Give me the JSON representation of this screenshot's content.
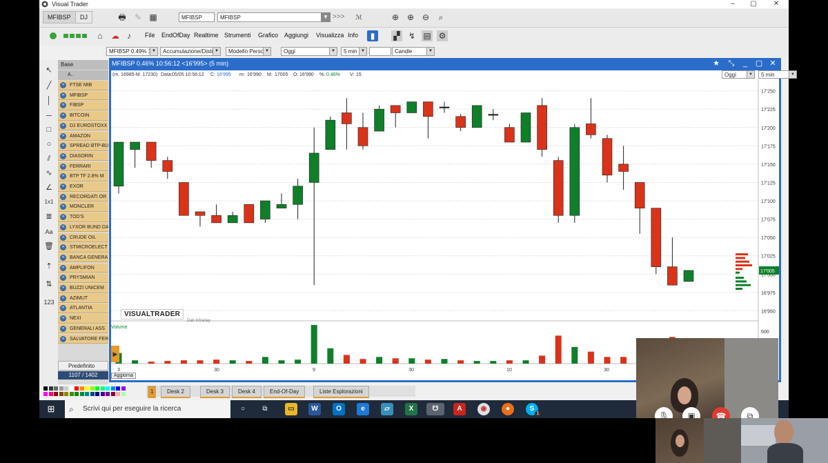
{
  "window": {
    "title": "Visual Trader"
  },
  "tabs": [
    "MFIBSP",
    "DJ"
  ],
  "symbol_inputs": {
    "left": "MFIBSP",
    "right": "MFIBSP"
  },
  "forward_label": ">>>",
  "menu": [
    "File",
    "EndOfDay",
    "Realtime",
    "Strumenti",
    "Grafico",
    "Aggiungi",
    "Visualizza",
    "Info"
  ],
  "toolbar3": {
    "instrument": "MFIBSP 0.49% 10:",
    "mode": "Accumulazione/Distri",
    "model": "Modello Person",
    "period": "Oggi",
    "interval": "5 min",
    "blank": "",
    "style": "Candle"
  },
  "watchlist": {
    "header": "Base",
    "column_header": "A.. Denominazione",
    "items": [
      "FTSE MIB",
      "MFIBSP",
      "FIBSP",
      "BITCOIN",
      "DJ EUROSTOXX",
      "AMAZON",
      "SPREAD BTP-BU",
      "DIASORIN",
      "FERRARI",
      "BTP TF 2.8% M",
      "EXOR",
      "RECORDATI OR",
      "MONCLER",
      "TOD'S",
      "LYXOR BUND DA",
      "CRUDE OIL",
      "STMICROELECT",
      "BANCA GENERA",
      "AMPLIFON",
      "PRYSMIAN",
      "BUZZI UNICEM",
      "AZIMUT",
      "ATLANTIA",
      "NEXI",
      "GENERALI ASS",
      "SALVATORE FER"
    ],
    "footer": "Predefinito",
    "count": "1107 / 1402"
  },
  "chart_window": {
    "title": "MFIBSP 0.46% 10:56:12  <16'995> (5 min)",
    "period": "Oggi",
    "interval": "5 min",
    "info": {
      "range": "(m. 16985-M. 17230)",
      "date_label": "Data:",
      "date": "05/05 10:56:12",
      "c_label": "C:",
      "c": "16'995",
      "m_label": "m:",
      "m": "16'990",
      "M_label": "M:",
      "M": "17005",
      "o_label": "O:",
      "o": "16'990",
      "pct_label": "%:",
      "pct": "0.46%",
      "v_label": "V:",
      "v": "15"
    },
    "brand": "VISUALTRADER",
    "brand_sub": "Dati Intraday",
    "volume_label": "Volume",
    "update_button": "Aggiorna",
    "last_price_tag": "17'005",
    "x_ticks": [
      "3",
      "30",
      "9",
      "30",
      "10",
      "30"
    ],
    "y_ticks": [
      "17'250",
      "17'225",
      "17'200",
      "17'175",
      "17'150",
      "17'125",
      "17'100",
      "17'075",
      "17'050",
      "17'025",
      "17'000",
      "16'975",
      "16'950"
    ],
    "vol_ticks": [
      "500",
      "37"
    ]
  },
  "chart_data": {
    "type": "candlestick",
    "ylim": [
      16940,
      17260
    ],
    "y_ticks": [
      17250,
      17225,
      17200,
      17175,
      17150,
      17125,
      17100,
      17075,
      17050,
      17025,
      17000,
      16975,
      16950
    ],
    "candles": [
      {
        "o": 17120,
        "h": 17180,
        "l": 17110,
        "c": 17180
      },
      {
        "o": 17170,
        "h": 17180,
        "l": 17145,
        "c": 17180
      },
      {
        "o": 17180,
        "h": 17180,
        "l": 17145,
        "c": 17155
      },
      {
        "o": 17155,
        "h": 17160,
        "l": 17130,
        "c": 17140
      },
      {
        "o": 17125,
        "h": 17125,
        "l": 17080,
        "c": 17080
      },
      {
        "o": 17085,
        "h": 17085,
        "l": 17065,
        "c": 17080
      },
      {
        "o": 17080,
        "h": 17095,
        "l": 17070,
        "c": 17070
      },
      {
        "o": 17070,
        "h": 17085,
        "l": 17070,
        "c": 17080
      },
      {
        "o": 17095,
        "h": 17095,
        "l": 17070,
        "c": 17070
      },
      {
        "o": 17075,
        "h": 17100,
        "l": 17070,
        "c": 17100
      },
      {
        "o": 17090,
        "h": 17110,
        "l": 17090,
        "c": 17095
      },
      {
        "o": 17095,
        "h": 17130,
        "l": 17075,
        "c": 17120
      },
      {
        "o": 17125,
        "h": 17200,
        "l": 16985,
        "c": 17165
      },
      {
        "o": 17170,
        "h": 17215,
        "l": 17170,
        "c": 17210
      },
      {
        "o": 17220,
        "h": 17240,
        "l": 17170,
        "c": 17205
      },
      {
        "o": 17200,
        "h": 17220,
        "l": 17170,
        "c": 17175
      },
      {
        "o": 17195,
        "h": 17230,
        "l": 17195,
        "c": 17225
      },
      {
        "o": 17230,
        "h": 17230,
        "l": 17200,
        "c": 17220
      },
      {
        "o": 17220,
        "h": 17235,
        "l": 17220,
        "c": 17235
      },
      {
        "o": 17235,
        "h": 17235,
        "l": 17185,
        "c": 17215
      },
      {
        "o": 17228,
        "h": 17235,
        "l": 17220,
        "c": 17228
      },
      {
        "o": 17215,
        "h": 17218,
        "l": 17195,
        "c": 17200
      },
      {
        "o": 17200,
        "h": 17230,
        "l": 17200,
        "c": 17230
      },
      {
        "o": 17218,
        "h": 17225,
        "l": 17210,
        "c": 17218
      },
      {
        "o": 17200,
        "h": 17205,
        "l": 17180,
        "c": 17180
      },
      {
        "o": 17180,
        "h": 17220,
        "l": 17180,
        "c": 17220
      },
      {
        "o": 17230,
        "h": 17240,
        "l": 17160,
        "c": 17170
      },
      {
        "o": 17155,
        "h": 17160,
        "l": 17070,
        "c": 17080
      },
      {
        "o": 17080,
        "h": 17205,
        "l": 17070,
        "c": 17200
      },
      {
        "o": 17205,
        "h": 17240,
        "l": 17185,
        "c": 17190
      },
      {
        "o": 17185,
        "h": 17190,
        "l": 17125,
        "c": 17135
      },
      {
        "o": 17150,
        "h": 17175,
        "l": 17115,
        "c": 17140
      },
      {
        "o": 17125,
        "h": 17125,
        "l": 17055,
        "c": 17090
      },
      {
        "o": 17090,
        "h": 17090,
        "l": 17000,
        "c": 17010
      },
      {
        "o": 17010,
        "h": 17050,
        "l": 16985,
        "c": 16985
      },
      {
        "o": 16990,
        "h": 17005,
        "l": 16990,
        "c": 17005
      }
    ],
    "volume": [
      16,
      5,
      3,
      4,
      5,
      5,
      6,
      5,
      4,
      10,
      5,
      6,
      58,
      23,
      13,
      7,
      10,
      8,
      8,
      6,
      7,
      5,
      4,
      4,
      5,
      5,
      12,
      42,
      25,
      18,
      10,
      10,
      12,
      38,
      40,
      10
    ]
  },
  "desks": [
    "1",
    "Desk 2",
    "Desk 3",
    "Desk 4",
    "End-Of-Day",
    "Liste Esplorazioni"
  ],
  "taskbar": {
    "search_placeholder": "Scrivi qui per eseguire la ricerca",
    "apps": [
      "task-view",
      "explorer",
      "word",
      "outlook",
      "edge",
      "notes",
      "excel",
      "visualtrader",
      "acrobat",
      "chrome",
      "firefox",
      "skype"
    ],
    "skype_badge": "1"
  },
  "colors": {
    "accent": "#2a6cc9",
    "up": "#0f7f2a",
    "down": "#d9331a",
    "watchlist_row": "#e9c98a"
  }
}
